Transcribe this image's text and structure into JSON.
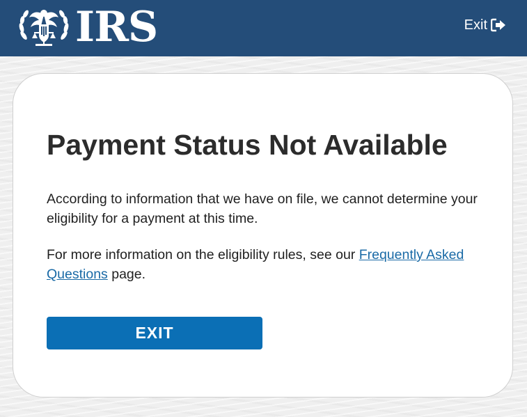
{
  "header": {
    "logo_text": "IRS",
    "exit_label": "Exit"
  },
  "card": {
    "title": "Payment Status Not Available",
    "paragraph1": "According to information that we have on file, we cannot determine your eligibility for a payment at this time.",
    "paragraph2_before": "For more information on the eligibility rules, see our ",
    "faq_link": "Frequently Asked Questions",
    "paragraph2_after": " page.",
    "exit_button": "EXIT"
  },
  "icons": {
    "logo": "irs-eagle-icon",
    "exit": "sign-out-icon"
  },
  "colors": {
    "header_bg": "#244d79",
    "button_bg": "#0b6fb5",
    "link": "#1a6aa6",
    "title": "#2c2c2c"
  }
}
